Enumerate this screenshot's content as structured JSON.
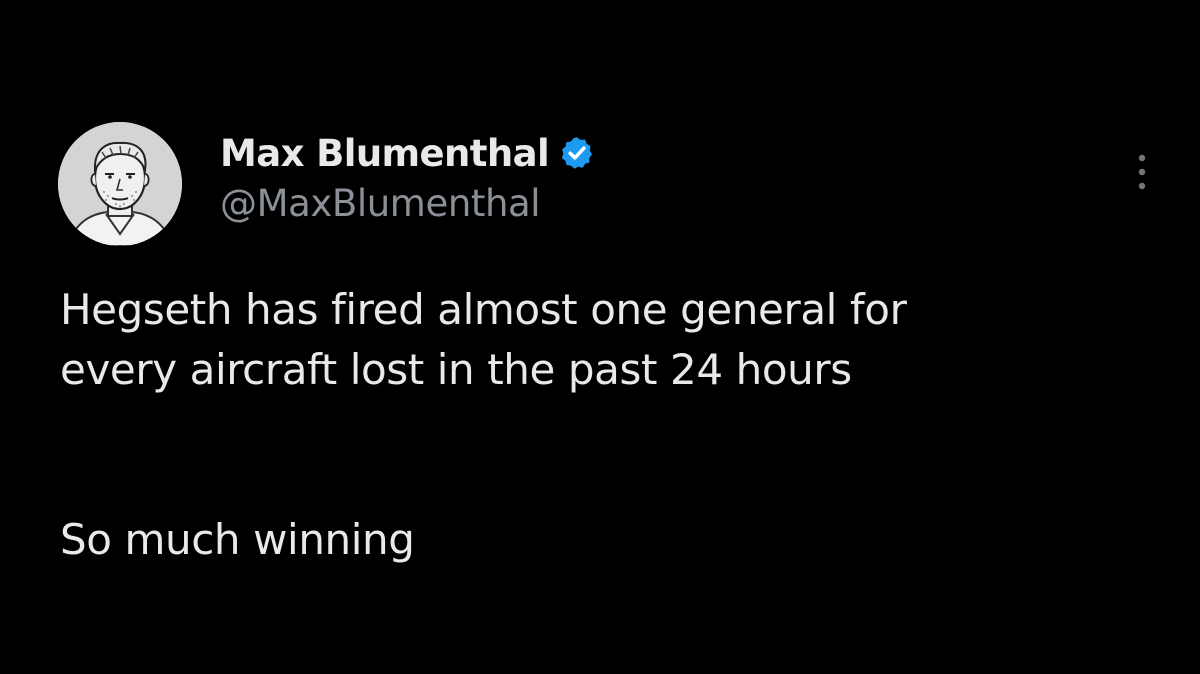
{
  "author": {
    "display_name": "Max Blumenthal",
    "handle": "@MaxBlumenthal",
    "verified": true,
    "avatar_icon": "sketch-portrait-avatar",
    "verified_icon": "verified-badge-icon",
    "verified_color": "#1d9bf0"
  },
  "menu": {
    "icon": "more-options-icon"
  },
  "tweet": {
    "lines": [
      "Hegseth has fired almost one general for",
      "every aircraft lost in the past 24 hours"
    ],
    "closing": "So much winning"
  },
  "colors": {
    "background": "#000000",
    "text": "#e7e9ea",
    "secondary_text": "#8b9096"
  }
}
